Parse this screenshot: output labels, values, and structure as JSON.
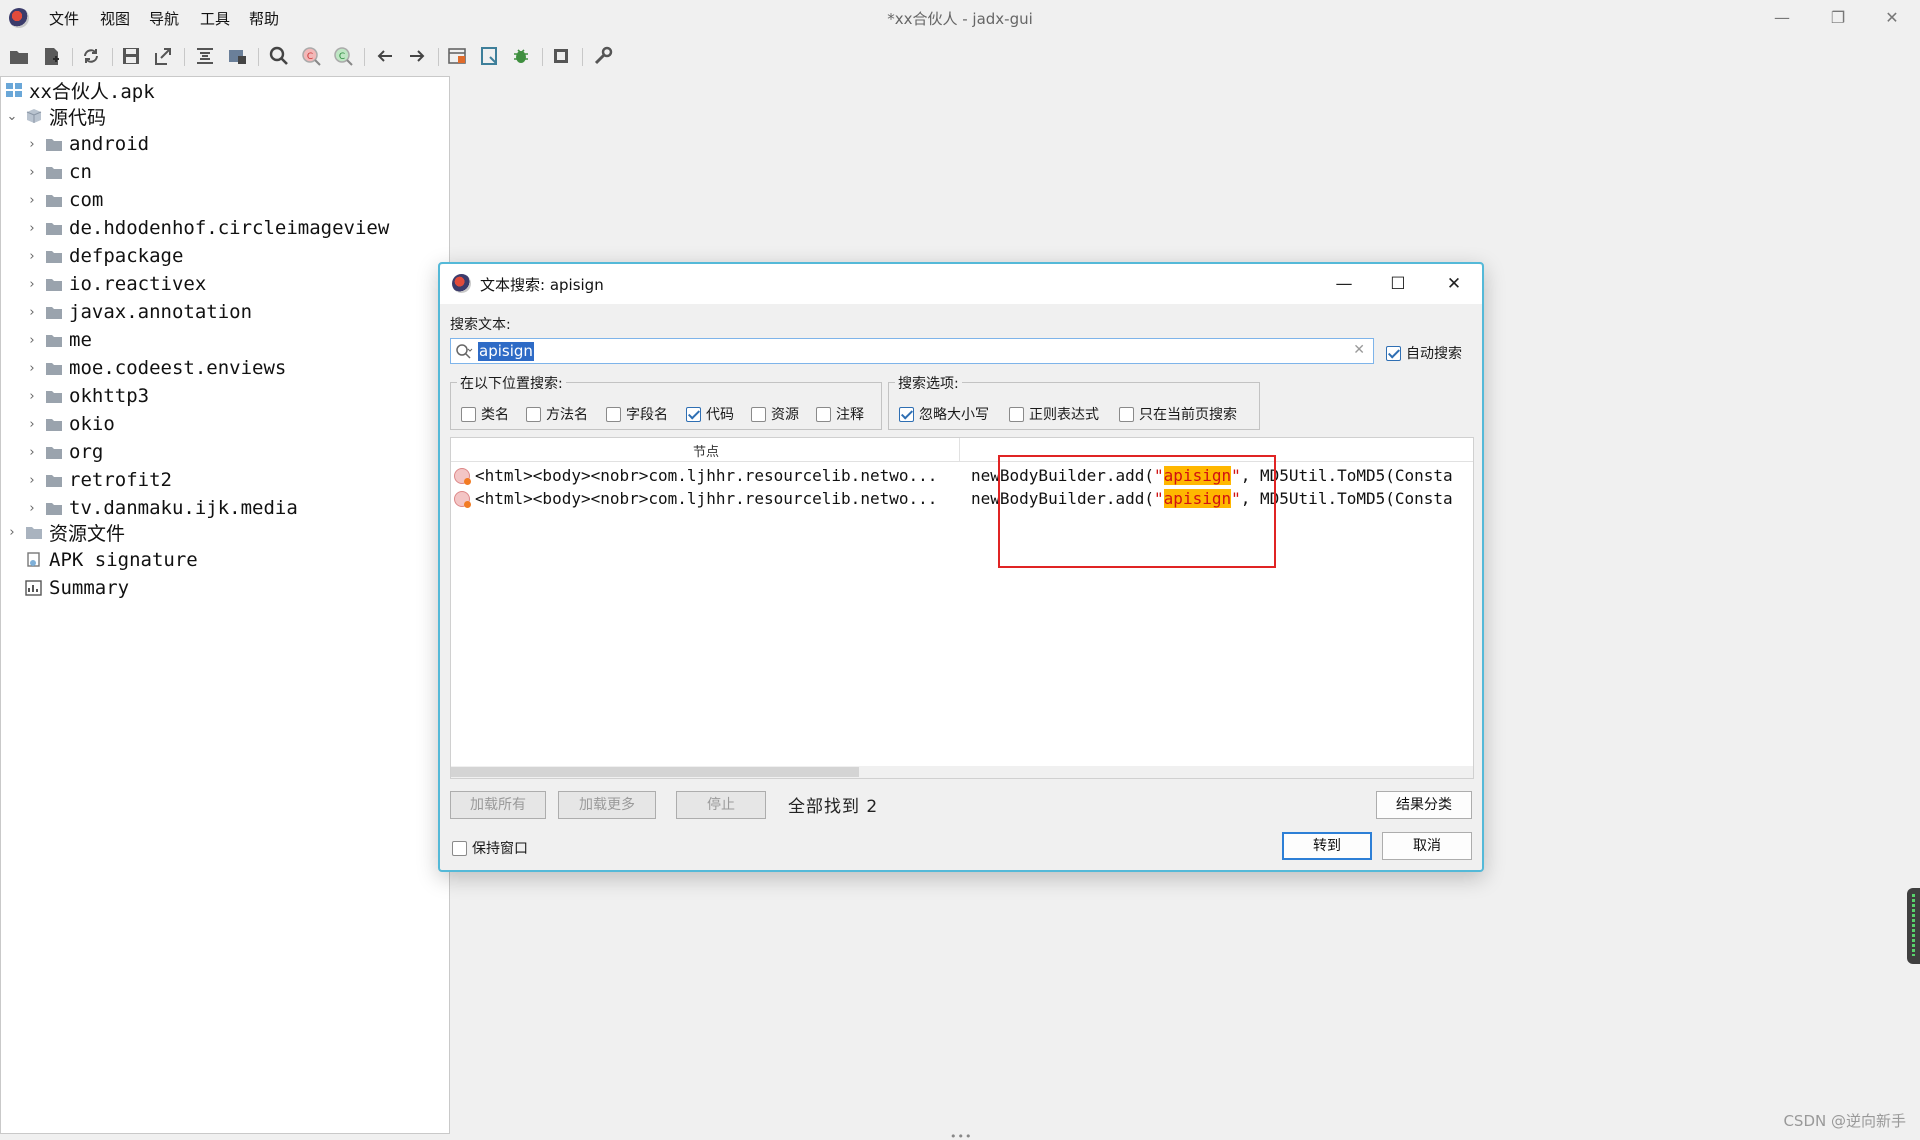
{
  "window": {
    "title": "*xx合伙人 - jadx-gui",
    "menu": [
      "文件",
      "视图",
      "导航",
      "工具",
      "帮助"
    ],
    "controls": {
      "minimize": "—",
      "restore": "❐",
      "close": "✕"
    }
  },
  "toolbar": {
    "icons": [
      "open-folder-icon",
      "add-files-icon",
      "sync-icon",
      "save-all-icon",
      "export-icon",
      "sync-with-editor-icon",
      "flatten-packages-icon",
      "search-icon",
      "search-class-icon",
      "search-usage-icon",
      "back-icon",
      "forward-icon",
      "deobfuscation-icon",
      "log-viewer-icon",
      "debug-icon",
      "stop-icon",
      "preferences-icon"
    ]
  },
  "tree": {
    "root": "xx合伙人.apk",
    "source_code": "源代码",
    "packages": [
      "android",
      "cn",
      "com",
      "de.hdodenhof.circleimageview",
      "defpackage",
      "io.reactivex",
      "javax.annotation",
      "me",
      "moe.codeest.enviews",
      "okhttp3",
      "okio",
      "org",
      "retrofit2",
      "tv.danmaku.ijk.media"
    ],
    "resources": "资源文件",
    "apk_signature": "APK signature",
    "summary": "Summary"
  },
  "dialog": {
    "title": "文本搜索: apisign",
    "search_label": "搜索文本:",
    "search_value": "apisign",
    "auto_search": {
      "label": "自动搜索",
      "checked": true
    },
    "search_in": {
      "title": "在以下位置搜索:",
      "options": [
        {
          "label": "类名",
          "checked": false
        },
        {
          "label": "方法名",
          "checked": false
        },
        {
          "label": "字段名",
          "checked": false
        },
        {
          "label": "代码",
          "checked": true
        },
        {
          "label": "资源",
          "checked": false
        },
        {
          "label": "注释",
          "checked": false
        }
      ]
    },
    "search_options": {
      "title": "搜索选项:",
      "options": [
        {
          "label": "忽略大小写",
          "checked": true
        },
        {
          "label": "正则表达式",
          "checked": false
        },
        {
          "label": "只在当前页搜索",
          "checked": false
        }
      ]
    },
    "results": {
      "column_node": "节点",
      "rows": [
        {
          "node": "<html><body><nobr>com.ljhhr.resourcelib.netwo...",
          "code_prefix": "newBodyBuilder.add(",
          "q1": "\"",
          "match": "apisign",
          "q2": "\"",
          "code_suffix": ", MD5Util.ToMD5(Consta"
        },
        {
          "node": "<html><body><nobr>com.ljhhr.resourcelib.netwo...",
          "code_prefix": "newBodyBuilder.add(",
          "q1": "\"",
          "match": "apisign",
          "q2": "\"",
          "code_suffix": ", MD5Util.ToMD5(Consta"
        }
      ]
    },
    "buttons": {
      "load_all": "加载所有",
      "load_more": "加载更多",
      "stop": "停止",
      "found_text": "全部找到  2",
      "sort": "结果分类",
      "keep_open": "保持窗口",
      "goto": "转到",
      "cancel": "取消"
    },
    "controls": {
      "minimize": "—",
      "maximize": "☐",
      "close": "✕"
    }
  },
  "watermark": "CSDN @逆向新手",
  "bottom_grip": "•••"
}
